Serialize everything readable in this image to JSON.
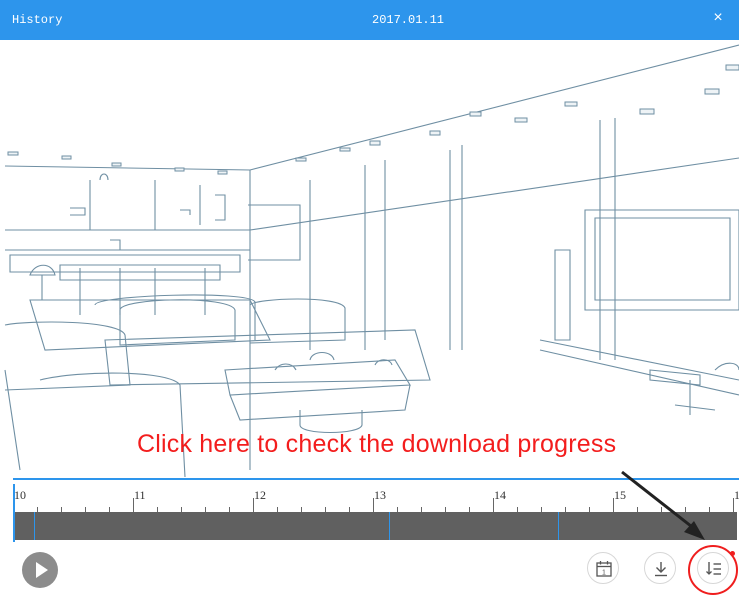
{
  "window": {
    "title": "History",
    "date": "2017.01.11",
    "close_symbol": "×"
  },
  "annotation": {
    "text": "Click here to check the download progress",
    "color": "#f31d1d"
  },
  "timeline": {
    "ticks": [
      "10",
      "11",
      "12",
      "13",
      "14",
      "15",
      "1"
    ],
    "accent": "#2d95ec",
    "track_color": "#606060"
  },
  "controls": {
    "play_icon": "play-icon",
    "calendar_icon": "calendar-icon",
    "calendar_day": "1",
    "download_icon": "download-icon",
    "progress_icon": "download-list-icon"
  }
}
